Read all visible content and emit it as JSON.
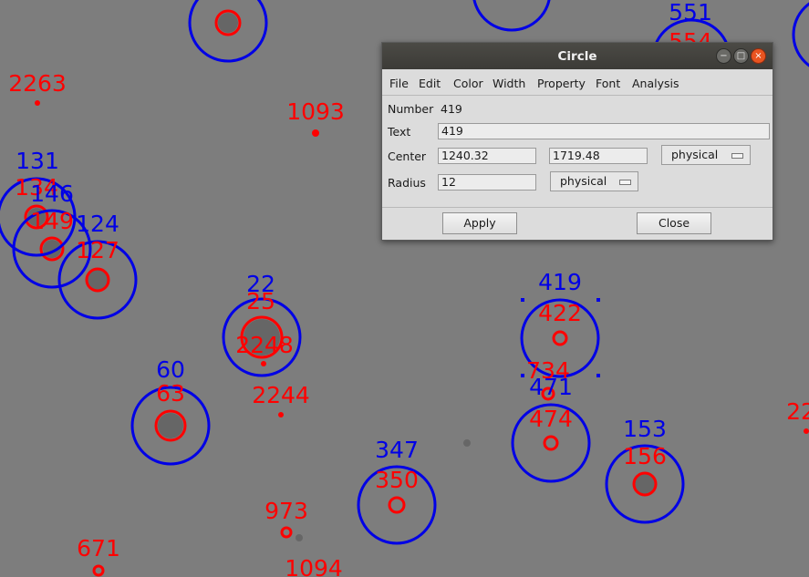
{
  "canvas": {
    "background": "#7d7d7d",
    "marker_colors": {
      "red": "#ff0000",
      "blue": "#0000e6",
      "source": "#666666"
    },
    "labels": [
      {
        "text": "2263",
        "color": "red"
      },
      {
        "text": "1093",
        "color": "red"
      },
      {
        "text": "551",
        "color": "blue"
      },
      {
        "text": "554",
        "color": "red"
      },
      {
        "text": "131",
        "color": "blue"
      },
      {
        "text": "134",
        "color": "red"
      },
      {
        "text": "146",
        "color": "blue"
      },
      {
        "text": "149",
        "color": "red"
      },
      {
        "text": "124",
        "color": "blue"
      },
      {
        "text": "127",
        "color": "red"
      },
      {
        "text": "22",
        "color": "blue"
      },
      {
        "text": "25",
        "color": "red"
      },
      {
        "text": "2248",
        "color": "red"
      },
      {
        "text": "2244",
        "color": "red"
      },
      {
        "text": "419",
        "color": "blue"
      },
      {
        "text": "422",
        "color": "red"
      },
      {
        "text": "734",
        "color": "red"
      },
      {
        "text": "471",
        "color": "blue"
      },
      {
        "text": "474",
        "color": "red"
      },
      {
        "text": "60",
        "color": "blue"
      },
      {
        "text": "63",
        "color": "red"
      },
      {
        "text": "153",
        "color": "blue"
      },
      {
        "text": "156",
        "color": "red"
      },
      {
        "text": "22",
        "color": "red"
      },
      {
        "text": "347",
        "color": "blue"
      },
      {
        "text": "350",
        "color": "red"
      },
      {
        "text": "973",
        "color": "red"
      },
      {
        "text": "671",
        "color": "red"
      },
      {
        "text": "1094",
        "color": "red"
      }
    ]
  },
  "dialog": {
    "title": "Circle",
    "window_buttons": {
      "minimize": "−",
      "maximize": "□",
      "close": "×"
    },
    "menu": [
      "File",
      "Edit",
      "Color",
      "Width",
      "Property",
      "Font",
      "Analysis"
    ],
    "number_label": "Number",
    "number_value": "419",
    "text_label": "Text",
    "text_value": "419",
    "center_label": "Center",
    "center_x": "1240.32",
    "center_y": "1719.48",
    "center_system": "physical",
    "radius_label": "Radius",
    "radius_value": "12",
    "radius_system": "physical",
    "apply_label": "Apply",
    "close_label": "Close"
  }
}
